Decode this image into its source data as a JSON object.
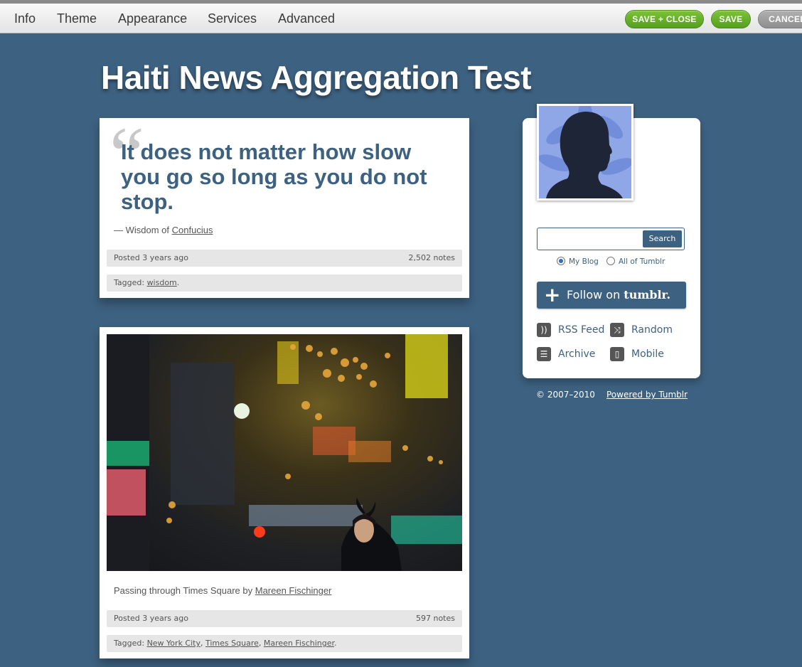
{
  "toolbar": {
    "tabs": [
      "Info",
      "Theme",
      "Appearance",
      "Services",
      "Advanced"
    ],
    "save_close_label": "SAVE + CLOSE",
    "save_label": "SAVE",
    "cancel_label": "CANCEL"
  },
  "blog": {
    "title": "Haiti News Aggregation Test"
  },
  "posts": [
    {
      "type": "quote",
      "quote": "It does not matter how slow you go so long as you do not stop.",
      "source_prefix": "— Wisdom of",
      "source_link": "Confucius",
      "posted": "Posted 3 years ago",
      "notes": "2,502 notes",
      "tagged_label": "Tagged:",
      "tags": [
        "wisdom"
      ]
    },
    {
      "type": "photo",
      "caption_prefix": "Passing through Times Square by",
      "caption_link": "Mareen Fischinger",
      "posted": "Posted 3 years ago",
      "notes": "597 notes",
      "tagged_label": "Tagged:",
      "tags": [
        "New York City",
        "Times Square",
        "Mareen Fischinger"
      ]
    }
  ],
  "sidebar": {
    "search_button": "Search",
    "search_value": "",
    "radio_options": [
      "My Blog",
      "All of Tumblr"
    ],
    "radio_selected": "My Blog",
    "follow_prefix": "Follow on",
    "follow_brand": "tumblr.",
    "links": [
      {
        "label": "RSS Feed",
        "icon": "rss-icon"
      },
      {
        "label": "Random",
        "icon": "shuffle-icon"
      },
      {
        "label": "Archive",
        "icon": "archive-icon"
      },
      {
        "label": "Mobile",
        "icon": "mobile-icon"
      }
    ]
  },
  "footer": {
    "copyright": "© 2007–2010",
    "powered": "Powered by Tumblr"
  },
  "colors": {
    "background": "#3d6180",
    "accent": "#3d6180",
    "save_green": "#6ab52b",
    "cancel_gray": "#9a9a9a"
  }
}
